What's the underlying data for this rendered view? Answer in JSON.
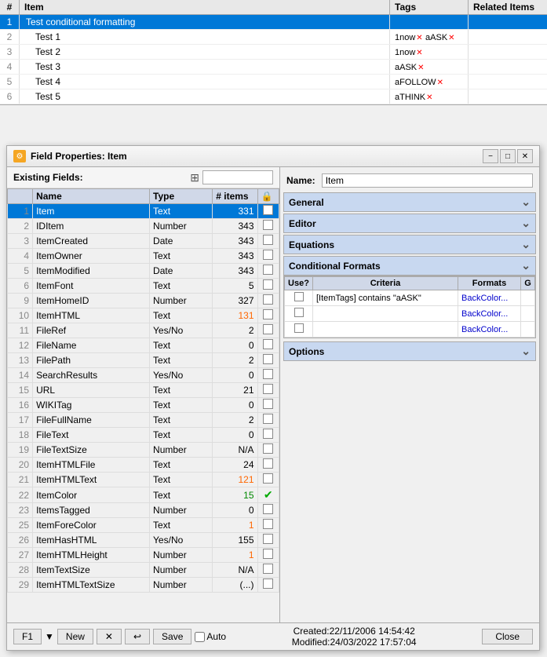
{
  "topGrid": {
    "headers": [
      "#",
      "Item",
      "Tags",
      "Related Items"
    ],
    "rows": [
      {
        "num": "1",
        "item": "Test conditional formatting",
        "tags": "",
        "related": "",
        "selected": true
      },
      {
        "num": "2",
        "item": "Test 1",
        "tags": "1now✕ aASK✕",
        "related": "",
        "selected": false
      },
      {
        "num": "3",
        "item": "Test 2",
        "tags": "1now✕",
        "related": "",
        "selected": false
      },
      {
        "num": "4",
        "item": "Test 3",
        "tags": "aASK✕",
        "related": "",
        "selected": false
      },
      {
        "num": "5",
        "item": "Test 4",
        "tags": "aFOLLOW✕",
        "related": "",
        "selected": false
      },
      {
        "num": "6",
        "item": "Test 5",
        "tags": "aTHINK✕",
        "related": "",
        "selected": false
      }
    ]
  },
  "dialog": {
    "title": "Field Properties: Item",
    "titlebarBtns": [
      "−",
      "□",
      "✕"
    ],
    "leftPanel": {
      "label": "Existing Fields:",
      "searchPlaceholder": "",
      "columns": [
        "",
        "Name",
        "Type",
        "# items",
        ""
      ],
      "rows": [
        {
          "num": "1",
          "name": "Item",
          "type": "Text",
          "items": "331",
          "checked": false,
          "selected": true
        },
        {
          "num": "2",
          "name": "IDItem",
          "type": "Number",
          "items": "343",
          "checked": false
        },
        {
          "num": "3",
          "name": "ItemCreated",
          "type": "Date",
          "items": "343",
          "checked": false
        },
        {
          "num": "4",
          "name": "ItemOwner",
          "type": "Text",
          "items": "343",
          "checked": false
        },
        {
          "num": "5",
          "name": "ItemModified",
          "type": "Date",
          "items": "343",
          "checked": false
        },
        {
          "num": "6",
          "name": "ItemFont",
          "type": "Text",
          "items": "5",
          "checked": false
        },
        {
          "num": "9",
          "name": "ItemHomeID",
          "type": "Number",
          "items": "327",
          "checked": false
        },
        {
          "num": "10",
          "name": "ItemHTML",
          "type": "Text",
          "items": "131",
          "checked": false
        },
        {
          "num": "11",
          "name": "FileRef",
          "type": "Yes/No",
          "items": "2",
          "checked": false
        },
        {
          "num": "12",
          "name": "FileName",
          "type": "Text",
          "items": "0",
          "checked": false
        },
        {
          "num": "13",
          "name": "FilePath",
          "type": "Text",
          "items": "2",
          "checked": false
        },
        {
          "num": "14",
          "name": "SearchResults",
          "type": "Yes/No",
          "items": "0",
          "checked": false
        },
        {
          "num": "15",
          "name": "URL",
          "type": "Text",
          "items": "21",
          "checked": false
        },
        {
          "num": "16",
          "name": "WIKITag",
          "type": "Text",
          "items": "0",
          "checked": false
        },
        {
          "num": "17",
          "name": "FileFullName",
          "type": "Text",
          "items": "2",
          "checked": false
        },
        {
          "num": "18",
          "name": "FileText",
          "type": "Text",
          "items": "0",
          "checked": false
        },
        {
          "num": "19",
          "name": "FileTextSize",
          "type": "Number",
          "items": "N/A",
          "checked": false
        },
        {
          "num": "20",
          "name": "ItemHTMLFile",
          "type": "Text",
          "items": "24",
          "checked": false
        },
        {
          "num": "21",
          "name": "ItemHTMLText",
          "type": "Text",
          "items": "121",
          "checked": false
        },
        {
          "num": "22",
          "name": "ItemColor",
          "type": "Text",
          "items": "15",
          "checked": true,
          "checkmark": true
        },
        {
          "num": "23",
          "name": "ItemsTagged",
          "type": "Number",
          "items": "0",
          "checked": false
        },
        {
          "num": "25",
          "name": "ItemForeColor",
          "type": "Text",
          "items": "1",
          "checked": false
        },
        {
          "num": "26",
          "name": "ItemHasHTML",
          "type": "Yes/No",
          "items": "155",
          "checked": false
        },
        {
          "num": "27",
          "name": "ItemHTMLHeight",
          "type": "Number",
          "items": "1",
          "checked": false
        },
        {
          "num": "28",
          "name": "ItemTextSize",
          "type": "Number",
          "items": "N/A",
          "checked": false
        },
        {
          "num": "29",
          "name": "ItemHTMLTextSize",
          "type": "Number",
          "items": "(...)",
          "checked": false
        }
      ]
    },
    "rightPanel": {
      "nameLabel": "Name:",
      "nameValue": "Item",
      "sections": {
        "general": "General",
        "editor": "Editor",
        "equations": "Equations",
        "conditionalFormats": "Conditional Formats",
        "options": "Options"
      },
      "conditionalFormatsTable": {
        "headers": [
          "Use?",
          "Criteria",
          "Formats",
          "G"
        ],
        "rows": [
          {
            "use": false,
            "criteria": "[ItemTags] contains \"aASK\"",
            "formats": "BackColor...",
            "g": ""
          },
          {
            "use": false,
            "criteria": "",
            "formats": "BackColor...",
            "g": ""
          },
          {
            "use": false,
            "criteria": "",
            "formats": "BackColor...",
            "g": ""
          }
        ]
      }
    },
    "statusbar": {
      "f1Label": "F1",
      "newLabel": "New",
      "saveLabel": "Save",
      "autoLabel": "Auto",
      "createdText": "Created:22/11/2006 14:54:42",
      "modifiedText": "Modified:24/03/2022 17:57:04",
      "closeLabel": "Close"
    }
  }
}
